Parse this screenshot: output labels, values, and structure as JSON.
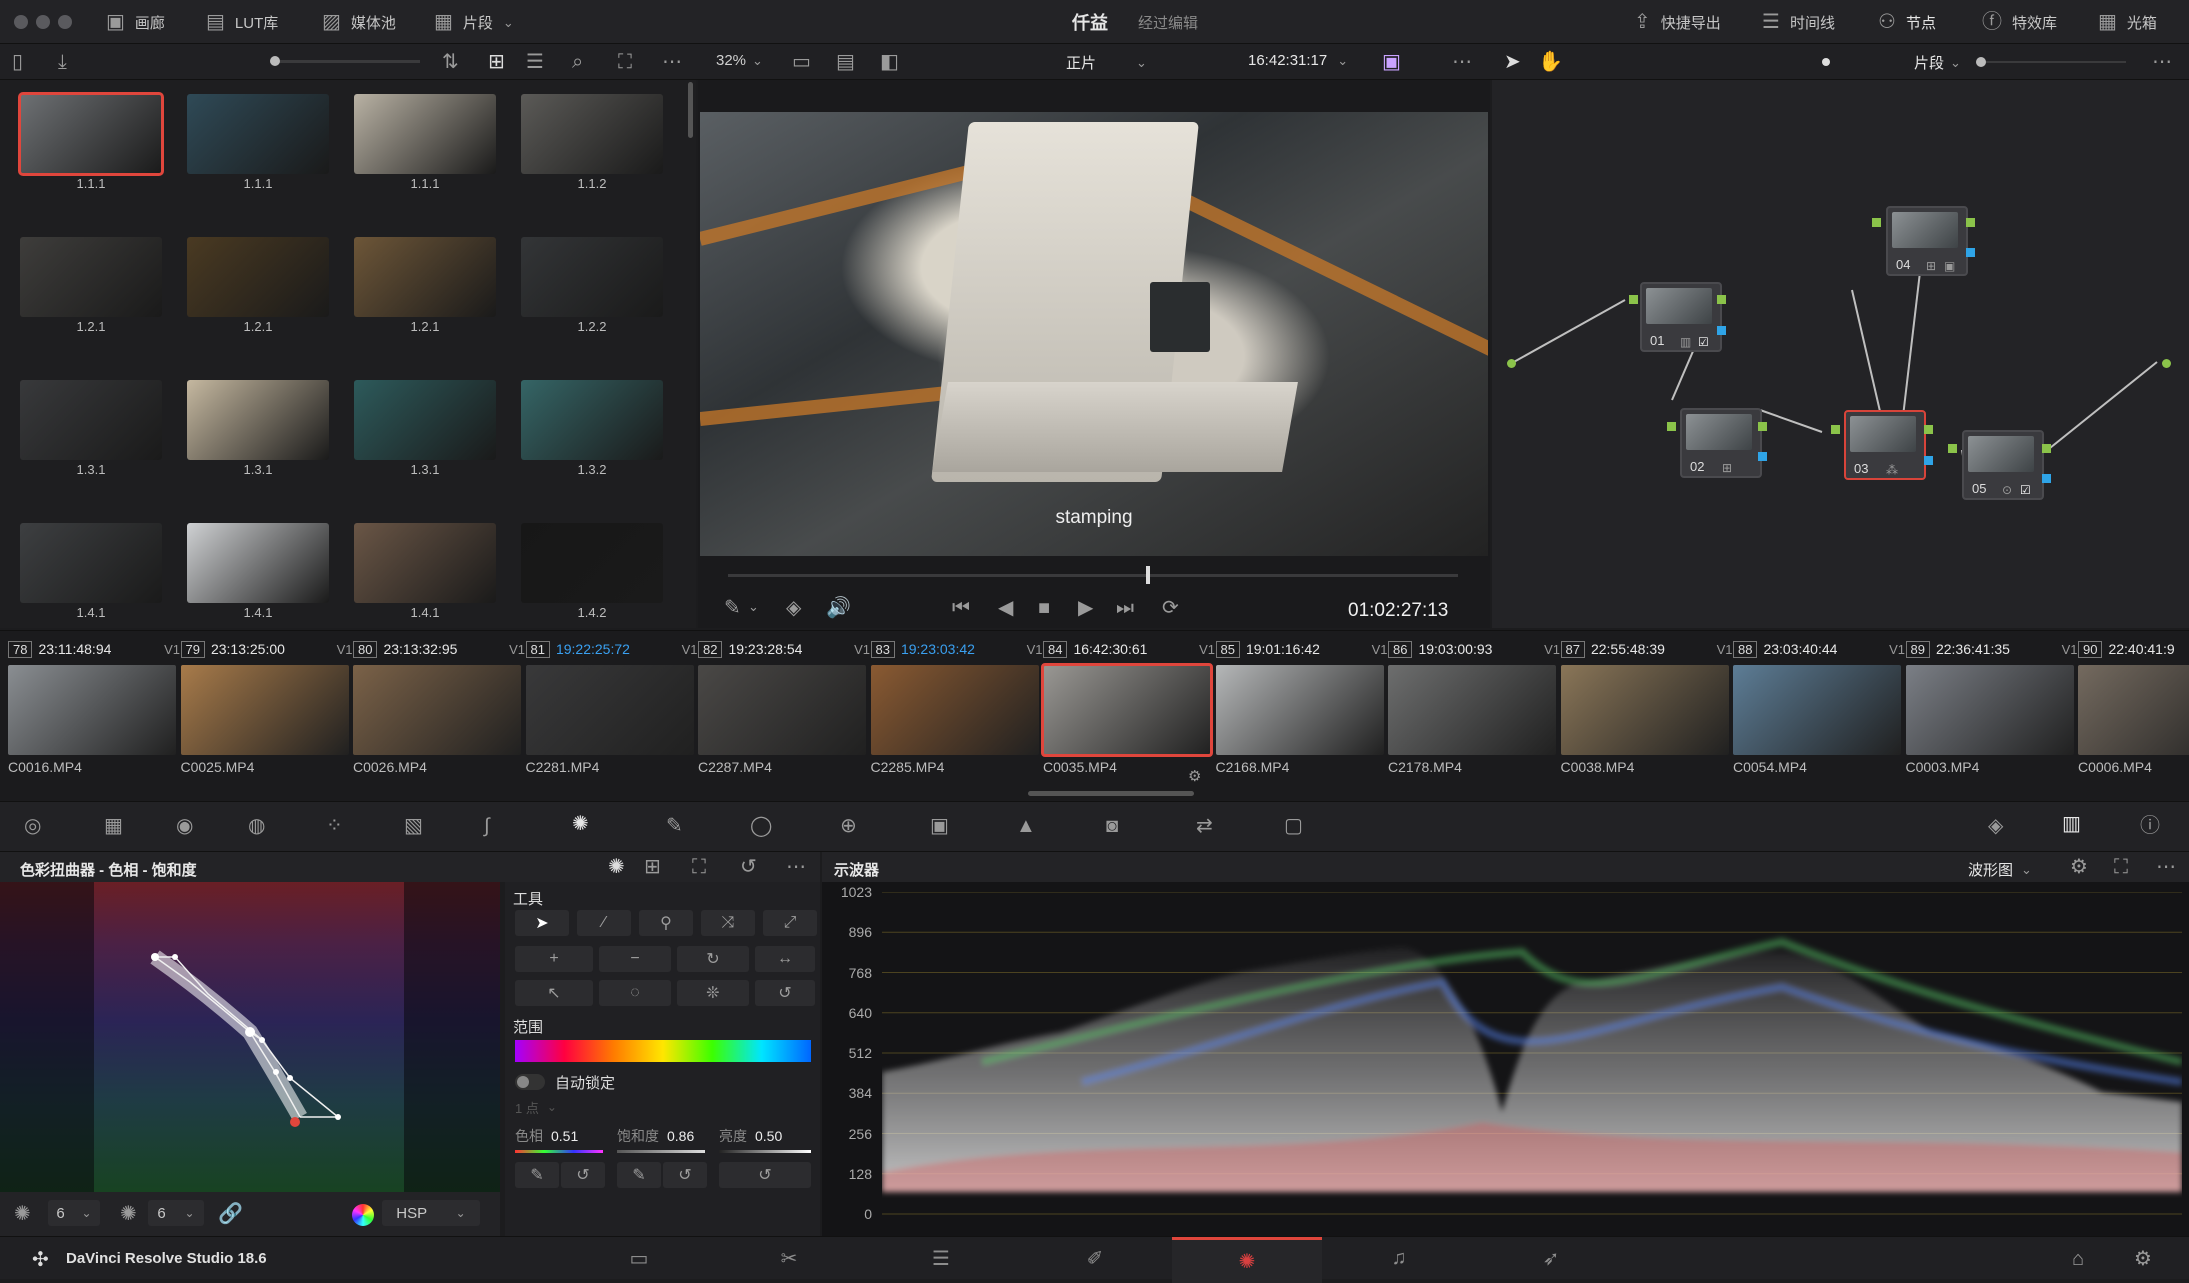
{
  "topbar": {
    "menu": [
      {
        "label": "画廊",
        "icon": "gallery-icon"
      },
      {
        "label": "LUT库",
        "icon": "lut-icon"
      },
      {
        "label": "媒体池",
        "icon": "media-pool-icon"
      },
      {
        "label": "片段",
        "icon": "clips-icon"
      }
    ],
    "project_title": "仟益",
    "project_state": "经过编辑",
    "right": [
      {
        "label": "快捷导出",
        "icon": "export-icon"
      },
      {
        "label": "时间线",
        "icon": "timeline-icon"
      },
      {
        "label": "节点",
        "icon": "nodes-icon"
      },
      {
        "label": "特效库",
        "icon": "fx-icon"
      },
      {
        "label": "光箱",
        "icon": "lightbox-icon"
      }
    ]
  },
  "viewer_bar": {
    "zoom": "32%",
    "mode": "正片",
    "timecode": "16:42:31:17",
    "nodes_mode": "片段"
  },
  "gallery": {
    "stills": [
      {
        "label": "1.1.1",
        "color": "#6e7174"
      },
      {
        "label": "1.1.1",
        "color": "#2f4a57"
      },
      {
        "label": "1.1.1",
        "color": "#b9b2a4"
      },
      {
        "label": "1.1.2",
        "color": "#5b5a57"
      },
      {
        "label": "1.2.1",
        "color": "#3e3d3b"
      },
      {
        "label": "1.2.1",
        "color": "#4a3a22"
      },
      {
        "label": "1.2.1",
        "color": "#6d5638"
      },
      {
        "label": "1.2.2",
        "color": "#333537"
      },
      {
        "label": "1.3.1",
        "color": "#38393b"
      },
      {
        "label": "1.3.1",
        "color": "#c5b8a0"
      },
      {
        "label": "1.3.1",
        "color": "#2d5a5b"
      },
      {
        "label": "1.3.2",
        "color": "#356566"
      },
      {
        "label": "1.4.1",
        "color": "#3d3f41"
      },
      {
        "label": "1.4.1",
        "color": "#cfd1d3"
      },
      {
        "label": "1.4.1",
        "color": "#6a5646"
      },
      {
        "label": "1.4.2",
        "color": "#171717"
      }
    ]
  },
  "viewer": {
    "caption": "stamping",
    "timecode": "01:02:27:13"
  },
  "nodes": [
    {
      "label": "01"
    },
    {
      "label": "02"
    },
    {
      "label": "03"
    },
    {
      "label": "04"
    },
    {
      "label": "05"
    }
  ],
  "clips": [
    {
      "num": "78",
      "tc": "23:11:48:94",
      "trk": "V1",
      "name": "C0016.MP4",
      "color": "#8a8e92",
      "blue": false
    },
    {
      "num": "79",
      "tc": "23:13:25:00",
      "trk": "V1",
      "name": "C0025.MP4",
      "color": "#a87b4a",
      "blue": false
    },
    {
      "num": "80",
      "tc": "23:13:32:95",
      "trk": "V1",
      "name": "C0026.MP4",
      "color": "#7b6248",
      "blue": false
    },
    {
      "num": "81",
      "tc": "19:22:25:72",
      "trk": "V1",
      "name": "C2281.MP4",
      "color": "#39393a",
      "blue": true
    },
    {
      "num": "82",
      "tc": "19:23:28:54",
      "trk": "V1",
      "name": "C2287.MP4",
      "color": "#4a4846",
      "blue": false
    },
    {
      "num": "83",
      "tc": "19:23:03:42",
      "trk": "V1",
      "name": "C2285.MP4",
      "color": "#8a5a32",
      "blue": true
    },
    {
      "num": "84",
      "tc": "16:42:30:61",
      "trk": "V1",
      "name": "C0035.MP4",
      "color": "#9a9894",
      "blue": false
    },
    {
      "num": "85",
      "tc": "19:01:16:42",
      "trk": "V1",
      "name": "C2168.MP4",
      "color": "#b5b7b8",
      "blue": false
    },
    {
      "num": "86",
      "tc": "19:03:00:93",
      "trk": "V1",
      "name": "C2178.MP4",
      "color": "#6d6e6e",
      "blue": false
    },
    {
      "num": "87",
      "tc": "22:55:48:39",
      "trk": "V1",
      "name": "C0038.MP4",
      "color": "#8a7658",
      "blue": false
    },
    {
      "num": "88",
      "tc": "23:03:40:44",
      "trk": "V1",
      "name": "C0054.MP4",
      "color": "#5d7d96",
      "blue": false
    },
    {
      "num": "89",
      "tc": "22:36:41:35",
      "trk": "V1",
      "name": "C0003.MP4",
      "color": "#7b7f86",
      "blue": false
    },
    {
      "num": "90",
      "tc": "22:40:41:9",
      "trk": "",
      "name": "C0006.MP4",
      "color": "#746a5f",
      "blue": false
    }
  ],
  "warper": {
    "title": "色彩扭曲器 - 色相 - 饱和度",
    "tools_label": "工具",
    "range_label": "范围",
    "auto_lock": "自动锁定",
    "points": "1 点",
    "hue_label": "色相",
    "hue": "0.51",
    "sat_label": "饱和度",
    "sat": "0.86",
    "lum_label": "亮度",
    "lum": "0.50",
    "grid_a": "6",
    "grid_b": "6",
    "colorspace": "HSP"
  },
  "scope": {
    "title": "示波器",
    "mode": "波形图",
    "ticks": [
      "1023",
      "896",
      "768",
      "640",
      "512",
      "384",
      "256",
      "128",
      "0"
    ]
  },
  "footer": {
    "app": "DaVinci Resolve Studio 18.6"
  }
}
